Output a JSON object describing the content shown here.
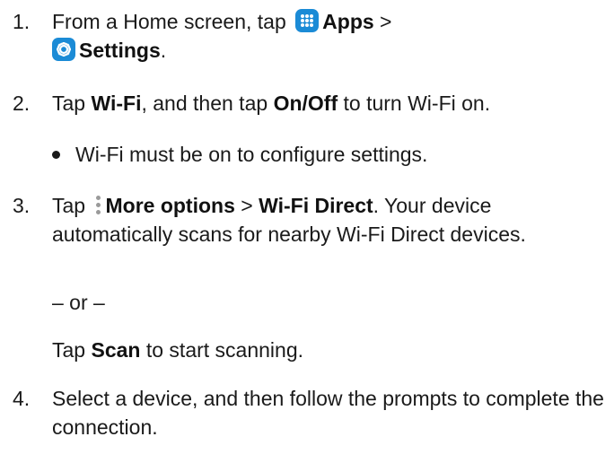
{
  "steps": {
    "s1": {
      "num": "1.",
      "pre": "From a Home screen, tap",
      "apps_icon": "apps-grid-icon",
      "apps": "Apps",
      "sep": ">",
      "settings_icon": "settings-gear-icon",
      "settings": "Settings",
      "end": "."
    },
    "s2": {
      "num": "2.",
      "t1": "Tap ",
      "wifi": "Wi-Fi",
      "t2": ", and then tap ",
      "onoff": "On/Off",
      "t3": " to turn Wi-Fi on."
    },
    "bullet": "Wi-Fi must be on to configure settings.",
    "s3": {
      "num": "3.",
      "t1": "Tap",
      "more_icon": "more-options-icon",
      "more": "More options",
      "sep": " > ",
      "direct": "Wi-Fi Direct",
      "t2": ". Your device automatically scans for nearby Wi-Fi Direct devices."
    },
    "or": "– or –",
    "scan_line": {
      "t1": "Tap ",
      "scan": "Scan",
      "t2": " to start scanning."
    },
    "s4": {
      "num": "4.",
      "text": "Select a device, and then follow the prompts to complete the connection."
    }
  }
}
